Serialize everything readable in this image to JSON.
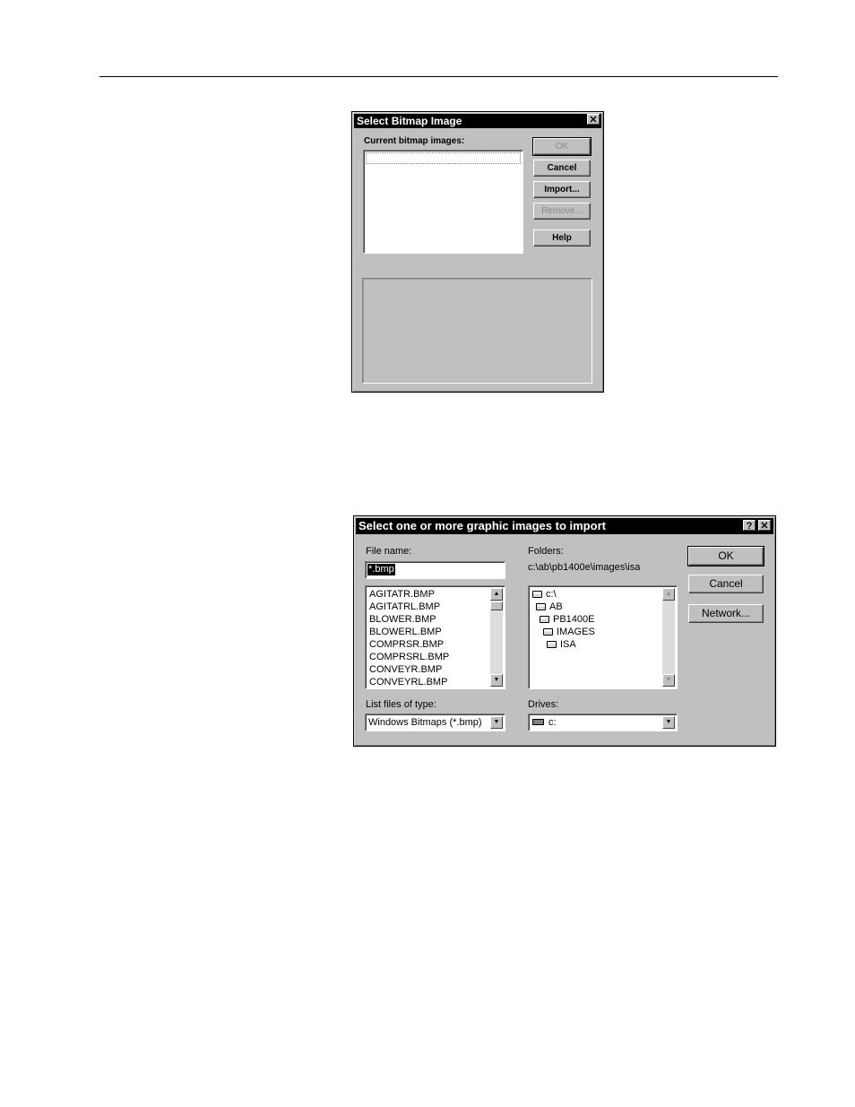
{
  "dialog1": {
    "title": "Select Bitmap Image",
    "close_glyph": "✕",
    "list_label": "Current bitmap images:",
    "buttons": {
      "ok": "OK",
      "cancel": "Cancel",
      "import": "Import...",
      "remove": "Remove...",
      "help": "Help"
    }
  },
  "dialog2": {
    "title": "Select one or more graphic images to import",
    "help_glyph": "?",
    "close_glyph": "✕",
    "file_name_label": "File name:",
    "file_name_value": "*.bmp",
    "files": [
      "AGITATR.BMP",
      "AGITATRL.BMP",
      "BLOWER.BMP",
      "BLOWERL.BMP",
      "COMPRSR.BMP",
      "COMPRSRL.BMP",
      "CONVEYR.BMP",
      "CONVEYRL.BMP"
    ],
    "folders_label": "Folders:",
    "current_path": "c:\\ab\\pb1400e\\images\\isa",
    "folders": [
      "c:\\",
      "AB",
      "PB1400E",
      "IMAGES",
      "ISA"
    ],
    "list_type_label": "List files of type:",
    "list_type_value": "Windows Bitmaps (*.bmp)",
    "drives_label": "Drives:",
    "drives_value": "c:",
    "buttons": {
      "ok": "OK",
      "cancel": "Cancel",
      "network": "Network..."
    }
  }
}
